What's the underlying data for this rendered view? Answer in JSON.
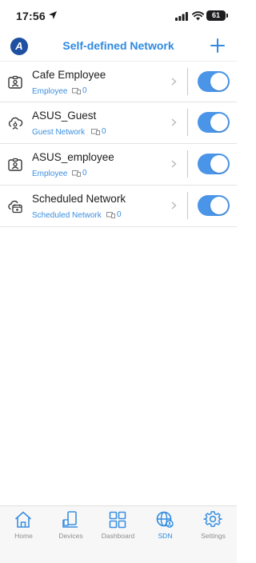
{
  "status_bar": {
    "time": "17:56",
    "battery": "61"
  },
  "header": {
    "logo_letter": "A",
    "title": "Self-defined Network"
  },
  "networks": [
    {
      "name": "Cafe Employee",
      "type": "Employee",
      "devices": "0",
      "icon": "employee-badge-icon",
      "enabled": true
    },
    {
      "name": "ASUS_Guest",
      "type": "Guest Network",
      "devices": "0",
      "icon": "guest-cloud-icon",
      "enabled": true
    },
    {
      "name": "ASUS_employee",
      "type": "Employee",
      "devices": "0",
      "icon": "employee-badge-icon",
      "enabled": true
    },
    {
      "name": "Scheduled Network",
      "type": "Scheduled Network",
      "devices": "0",
      "icon": "scheduled-network-icon",
      "enabled": true
    }
  ],
  "bottom_nav": [
    {
      "label": "Home",
      "icon": "home-icon",
      "active": false
    },
    {
      "label": "Devices",
      "icon": "devices-icon",
      "active": false
    },
    {
      "label": "Dashboard",
      "icon": "dashboard-icon",
      "active": false
    },
    {
      "label": "SDN",
      "icon": "sdn-globe-icon",
      "active": true
    },
    {
      "label": "Settings",
      "icon": "gear-icon",
      "active": false
    }
  ],
  "colors": {
    "accent": "#2f8ae0",
    "toggle_on": "#4a95e8",
    "inactive_nav": "#8e8e93"
  }
}
